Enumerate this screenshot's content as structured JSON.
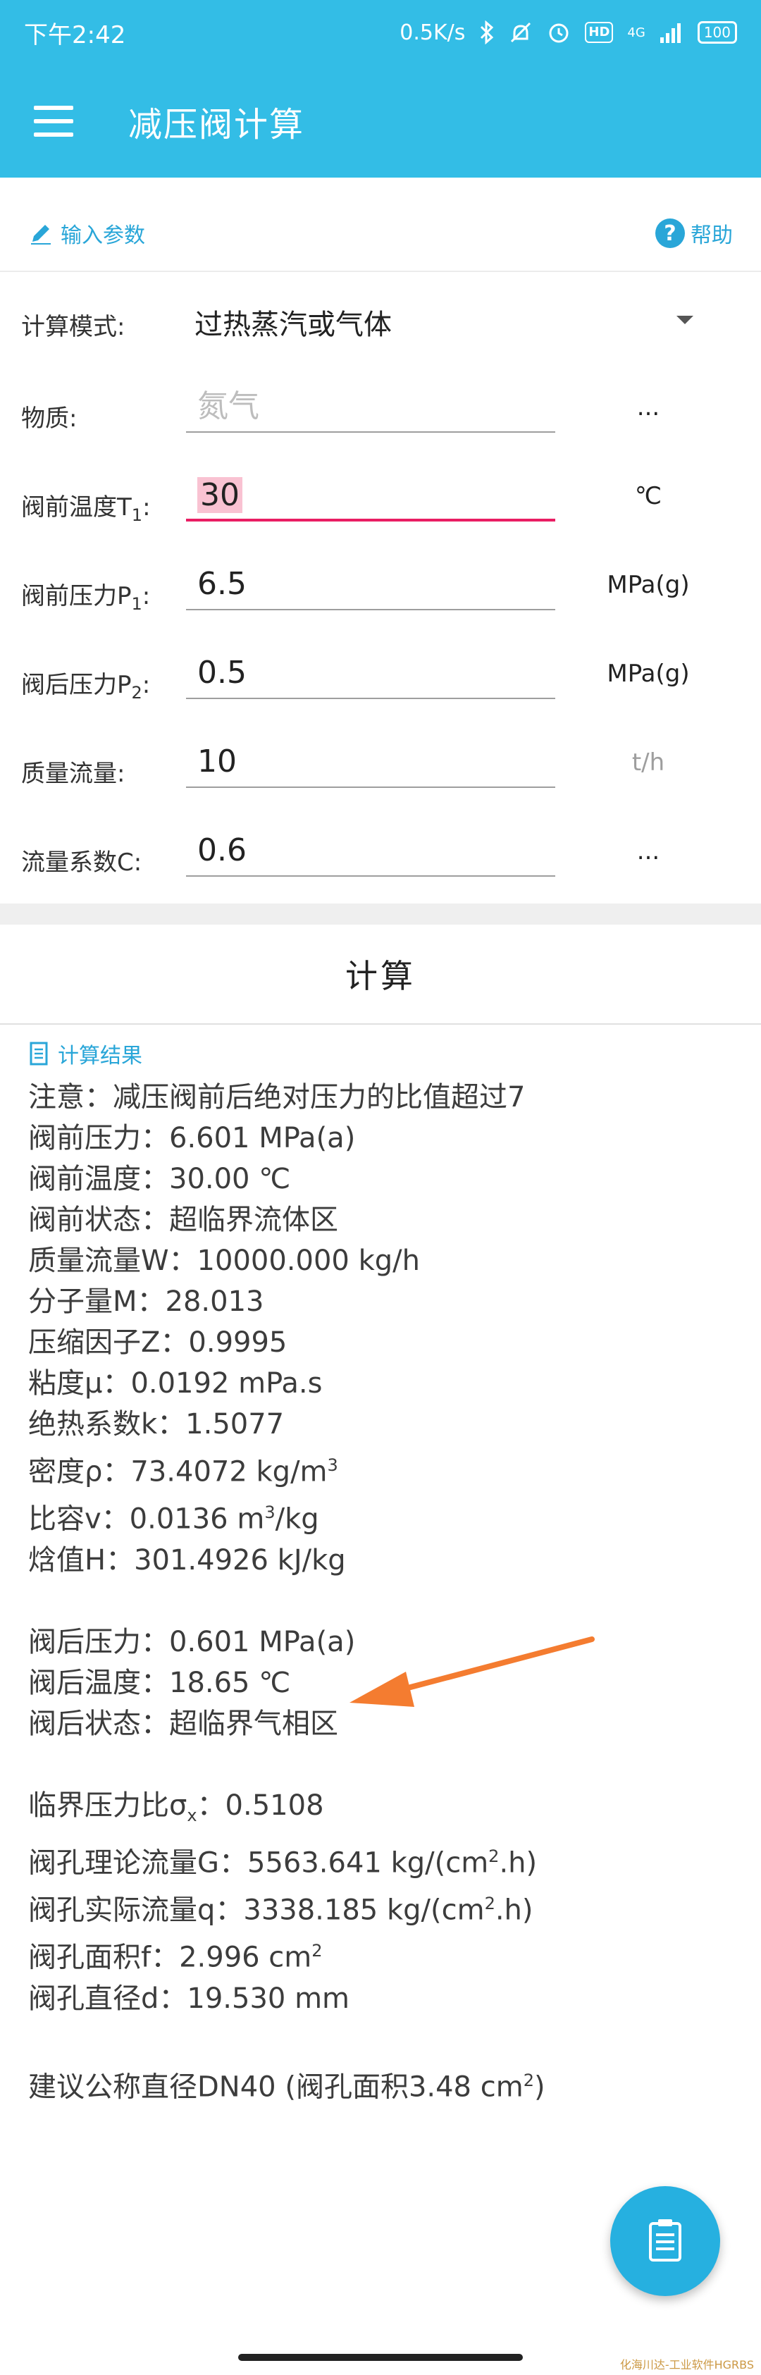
{
  "status_bar": {
    "time": "下午2:42",
    "speed": "0.5K/s",
    "hd": "HD",
    "network": "4G",
    "battery": "100",
    "icons": [
      "bluetooth-icon",
      "mute-icon",
      "alarm-icon",
      "hd-icon",
      "signal-icon",
      "battery-icon"
    ]
  },
  "app_bar": {
    "title": "减压阀计算"
  },
  "input_section": {
    "title": "输入参数",
    "help": "帮助"
  },
  "form": {
    "mode": {
      "label": "计算模式:",
      "value": "过热蒸汽或气体"
    },
    "substance": {
      "label": "物质:",
      "placeholder": "氮气",
      "button": "..."
    },
    "inlet_temp": {
      "label": "阀前温度T",
      "sub": "1",
      "colon": ":",
      "value": "30",
      "unit": "℃"
    },
    "inlet_pressure": {
      "label": "阀前压力P",
      "sub": "1",
      "colon": ":",
      "value": "6.5",
      "unit": "MPa(g)"
    },
    "outlet_pressure": {
      "label": "阀后压力P",
      "sub": "2",
      "colon": ":",
      "value": "0.5",
      "unit": "MPa(g)"
    },
    "mass_flow": {
      "label": "质量流量:",
      "value": "10",
      "unit": "t/h"
    },
    "flow_coef": {
      "label": "流量系数C:",
      "value": "0.6",
      "button": "..."
    }
  },
  "calc_button": "计算",
  "results_section": {
    "title": "计算结果"
  },
  "results": {
    "note": "注意：减压阀前后绝对压力的比值超过7",
    "p1": "阀前压力：6.601 MPa(a)",
    "t1": "阀前温度：30.00 ℃",
    "state1": "阀前状态：超临界流体区",
    "mass_flow": "质量流量W：10000.000 kg/h",
    "mol_weight": "分子量M：28.013",
    "z": "压缩因子Z：0.9995",
    "viscosity": "粘度μ：0.0192 mPa.s",
    "k": "绝热系数k：1.5077",
    "density_pre": "密度ρ：73.4072 kg/m",
    "density_sup": "3",
    "sv_pre": "比容v：0.0136 m",
    "sv_sup": "3",
    "sv_post": "/kg",
    "enthalpy": "焓值H：301.4926 kJ/kg",
    "p2": "阀后压力：0.601 MPa(a)",
    "t2": "阀后温度：18.65 ℃",
    "state2": "阀后状态：超临界气相区",
    "crit_pre": "临界压力比σ",
    "crit_sub": "x",
    "crit_post": "：0.5108",
    "g_pre": "阀孔理论流量G：5563.641 kg/(cm",
    "g_sup": "2",
    "g_post": ".h)",
    "q_pre": "阀孔实际流量q：3338.185 kg/(cm",
    "q_sup": "2",
    "q_post": ".h)",
    "area_pre": "阀孔面积f：2.996 cm",
    "area_sup": "2",
    "diameter": "阀孔直径d：19.530 mm",
    "suggest_pre": "建议公称直径DN40 (阀孔面积3.48 cm",
    "suggest_sup": "2",
    "suggest_post": ")"
  },
  "watermark": "化海川达-工业软件HGRBS",
  "colors": {
    "primary": "#33bde6",
    "accent": "#29a6d8",
    "arrow": "#f47c30",
    "focus": "#e91e63"
  }
}
